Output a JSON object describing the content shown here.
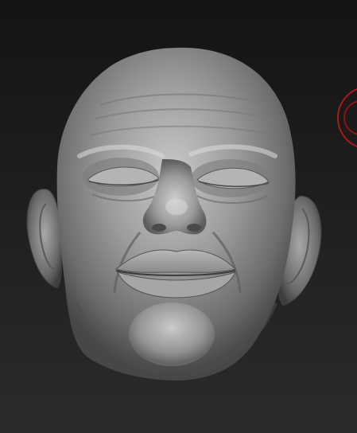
{
  "viewport": {
    "background_top": "#141414",
    "background_bottom": "#2b2b2b"
  },
  "model": {
    "material_color": "#8a8a8a",
    "highlight_color": "#d4d4d4",
    "shadow_color": "#3a3a3a"
  },
  "brush_cursor": {
    "color": "#b01818"
  }
}
